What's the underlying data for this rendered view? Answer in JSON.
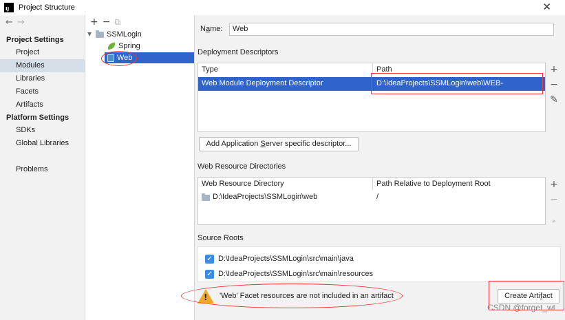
{
  "window": {
    "title": "Project Structure",
    "icon_text": "IJ",
    "close_glyph": "✕"
  },
  "sidebar": {
    "nav_back": "←",
    "nav_forward": "→",
    "project_settings_heading": "Project Settings",
    "project_items": [
      {
        "label": "Project"
      },
      {
        "label": "Modules",
        "selected": true
      },
      {
        "label": "Libraries"
      },
      {
        "label": "Facets"
      },
      {
        "label": "Artifacts"
      }
    ],
    "platform_settings_heading": "Platform Settings",
    "platform_items": [
      {
        "label": "SDKs"
      },
      {
        "label": "Global Libraries"
      }
    ],
    "problems_label": "Problems"
  },
  "tree": {
    "toolbar": {
      "add": "+",
      "remove": "−",
      "copy": "⧉"
    },
    "root": "SSMLogin",
    "children": [
      "Spring",
      "Web"
    ],
    "selected": "Web"
  },
  "facet": {
    "name_label_prefix": "N",
    "name_label_underlined": "a",
    "name_label_suffix": "me:",
    "name_value": "Web",
    "deployment_descriptors_title": "Deployment Descriptors",
    "descriptor_columns": [
      "Type",
      "Path"
    ],
    "descriptor_rows": [
      {
        "type": "Web Module Deployment Descriptor",
        "path": "D:\\IdeaProjects\\SSMLogin\\web\\WEB-INF\\web.xml"
      }
    ],
    "add_descriptor_button_prefix": "Add Application ",
    "add_descriptor_button_underlined": "S",
    "add_descriptor_button_suffix": "erver specific descriptor...",
    "web_resource_title": "Web Resource Directories",
    "web_resource_columns": [
      "Web Resource Directory",
      "Path Relative to Deployment Root"
    ],
    "web_resource_rows": [
      {
        "directory": "D:\\IdeaProjects\\SSMLogin\\web",
        "relative": "/"
      }
    ],
    "source_roots_title": "Source Roots",
    "source_roots": [
      {
        "path": "D:\\IdeaProjects\\SSMLogin\\src\\main\\java",
        "checked": true
      },
      {
        "path": "D:\\IdeaProjects\\SSMLogin\\src\\main\\resources",
        "checked": true
      }
    ],
    "warning_text": "'Web' Facet resources are not included in an artifact",
    "create_artifact_prefix": "Create Arti",
    "create_artifact_underlined": "f",
    "create_artifact_suffix": "act"
  },
  "tools": {
    "add": "+",
    "remove": "−",
    "edit": "✎",
    "more": "»"
  },
  "watermark": "CSDN @forget_wt",
  "colors": {
    "selection": "#2f65ca",
    "annotation_red": "#e33333",
    "checkbox": "#3d8ce4",
    "warning": "#f0a829"
  }
}
